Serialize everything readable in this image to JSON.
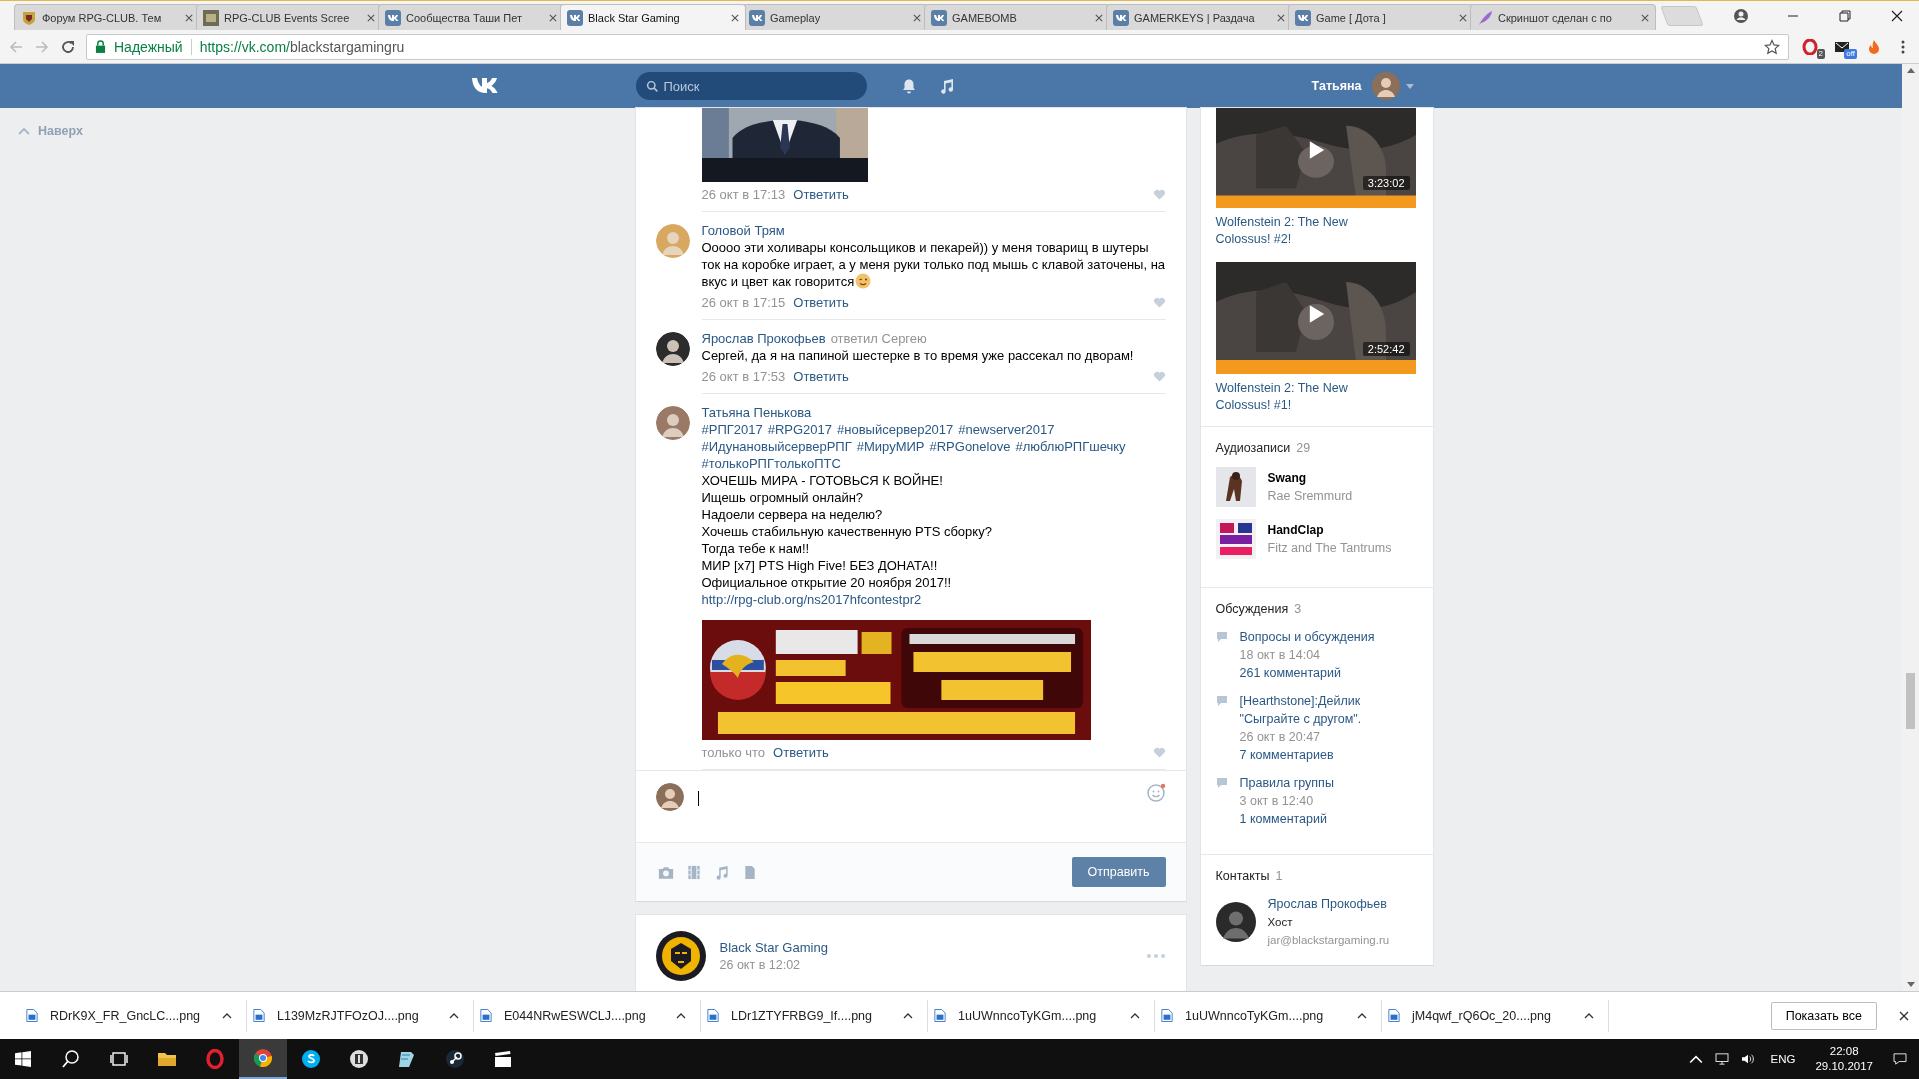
{
  "browser": {
    "tabs": [
      {
        "kind": "crest",
        "title": "Форум RPG-CLUB. Тем",
        "selected": false
      },
      {
        "kind": "thumb",
        "title": "RPG-CLUB Events Scree",
        "selected": false
      },
      {
        "kind": "vk",
        "title": "Сообщества Таши Пет",
        "selected": false
      },
      {
        "kind": "vk",
        "title": "Black Star Gaming",
        "selected": true
      },
      {
        "kind": "vk",
        "title": "Gameplay",
        "selected": false
      },
      {
        "kind": "vk",
        "title": "GAMEBOMB",
        "selected": false
      },
      {
        "kind": "vk",
        "title": "GAMERKEYS | Раздача",
        "selected": false
      },
      {
        "kind": "vk",
        "title": "Game [ Дота ]",
        "selected": false
      },
      {
        "kind": "feather",
        "title": "Скриншот сделан с по",
        "selected": false
      }
    ],
    "address": {
      "security": "Надежный",
      "scheme_host": "https://vk.com/",
      "path": "blackstargamingru"
    },
    "extensions": [
      {
        "kind": "opera",
        "badge": "2"
      },
      {
        "kind": "mail",
        "badge": "off"
      },
      {
        "kind": "fire"
      }
    ]
  },
  "header": {
    "search_placeholder": "Поиск",
    "user_name": "Татьяна"
  },
  "scroll_top": "Наверх",
  "comments": [
    {
      "attachment": {
        "kind": "picture"
      },
      "date": "26 окт в 17:13",
      "reply": "Ответить"
    },
    {
      "author": "Головой Трям",
      "text": "Ооооо эти холивары консольщиков и пекарей)) у меня товарищ в шутеры ток на коробке играет, а у меня руки только под мышь с клавой заточены, на вкус и цвет как говорится",
      "emoji": true,
      "date": "26 окт в 17:15",
      "reply": "Ответить"
    },
    {
      "author": "Ярослав Прокофьев",
      "reply_to": "ответил Сергею",
      "text": "Сергей, да я на папиной шестерке в то время уже рассекал по дворам!",
      "emoji": false,
      "date": "26 окт в 17:53",
      "reply": "Ответить"
    },
    {
      "author": "Татьяна Пенькова",
      "hashtags": [
        "#РПГ2017",
        "#RPG2017",
        "#новыйсервер2017",
        "#newserver2017",
        "#ИдунановыйсерверРПГ",
        "#МируМИР",
        "#RPGonelove",
        "#люблюРПГшечку",
        "#толькоРПГтолькоПТС"
      ],
      "lines": [
        "ХОЧЕШЬ МИРА - ГОТОВЬСЯ К ВОЙНЕ!",
        "Ищешь огромный онлайн?",
        "Надоели сервера на неделю?",
        "Хочешь стабильную качественную PTS сборку?",
        "Тогда тебе к нам!!",
        "МИР [x7] PTS High Five! БЕЗ ДОНАТА!!",
        "Официальное открытие 20 ноября 2017!!"
      ],
      "link": "http://rpg-club.org/ns2017hfcontestpr2",
      "attachment": {
        "kind": "picture"
      },
      "date": "только что",
      "reply": "Ответить"
    }
  ],
  "composer": {
    "send_label": "Отправить"
  },
  "next_post": {
    "author": "Black Star Gaming",
    "date": "26 окт в 12:02"
  },
  "videos": [
    {
      "duration": "3:23:02",
      "title": "Wolfenstein 2: The New Colossus! #2!"
    },
    {
      "duration": "2:52:42",
      "title": "Wolfenstein 2: The New Colossus! #1!"
    }
  ],
  "audio": {
    "title": "Аудиозаписи",
    "count": "29",
    "tracks": [
      {
        "title": "Swang",
        "artist": "Rae Sremmurd"
      },
      {
        "title": "HandClap",
        "artist": "Fitz and The Tantrums"
      }
    ]
  },
  "discussions": {
    "title": "Обсуждения",
    "count": "3",
    "topics": [
      {
        "title": "Вопросы и обсуждения",
        "date": "18 окт в 14:04",
        "comments": "261 комментарий"
      },
      {
        "title": "[Hearthstone]:Дейлик \"Сыграйте с другом\".",
        "date": "26 окт в 20:47",
        "comments": "7 комментариев"
      },
      {
        "title": "Правила группы",
        "date": "3 окт в 12:40",
        "comments": "1 комментарий"
      }
    ]
  },
  "contacts": {
    "title": "Контакты",
    "count": "1",
    "people": [
      {
        "name": "Ярослав Прокофьев",
        "role": "Хост",
        "email": "jar@blackstargaming.ru"
      }
    ]
  },
  "downloads": {
    "files": [
      "RDrK9X_FR_GncLC....png",
      "L139MzRJTFOzOJ....png",
      "E044NRwESWCLJ....png",
      "LDr1ZTYFRBG9_If....png",
      "1uUWnncoTyKGm....png",
      "1uUWnncoTyKGm....png",
      "jM4qwf_rQ6Oc_20....png"
    ],
    "show_all": "Показать все"
  },
  "taskbar": {
    "apps": [
      {
        "kind": "search",
        "active": false
      },
      {
        "kind": "taskview",
        "active": false
      },
      {
        "kind": "explorer",
        "active": false
      },
      {
        "kind": "opera",
        "active": false
      },
      {
        "kind": "chrome",
        "active": true
      },
      {
        "kind": "skype",
        "active": false
      },
      {
        "kind": "game",
        "active": false
      },
      {
        "kind": "notes",
        "active": false
      },
      {
        "kind": "steam",
        "active": false
      },
      {
        "kind": "clapper",
        "active": false
      }
    ],
    "language": "ENG",
    "time": "22:08",
    "date": "29.10.2017"
  }
}
